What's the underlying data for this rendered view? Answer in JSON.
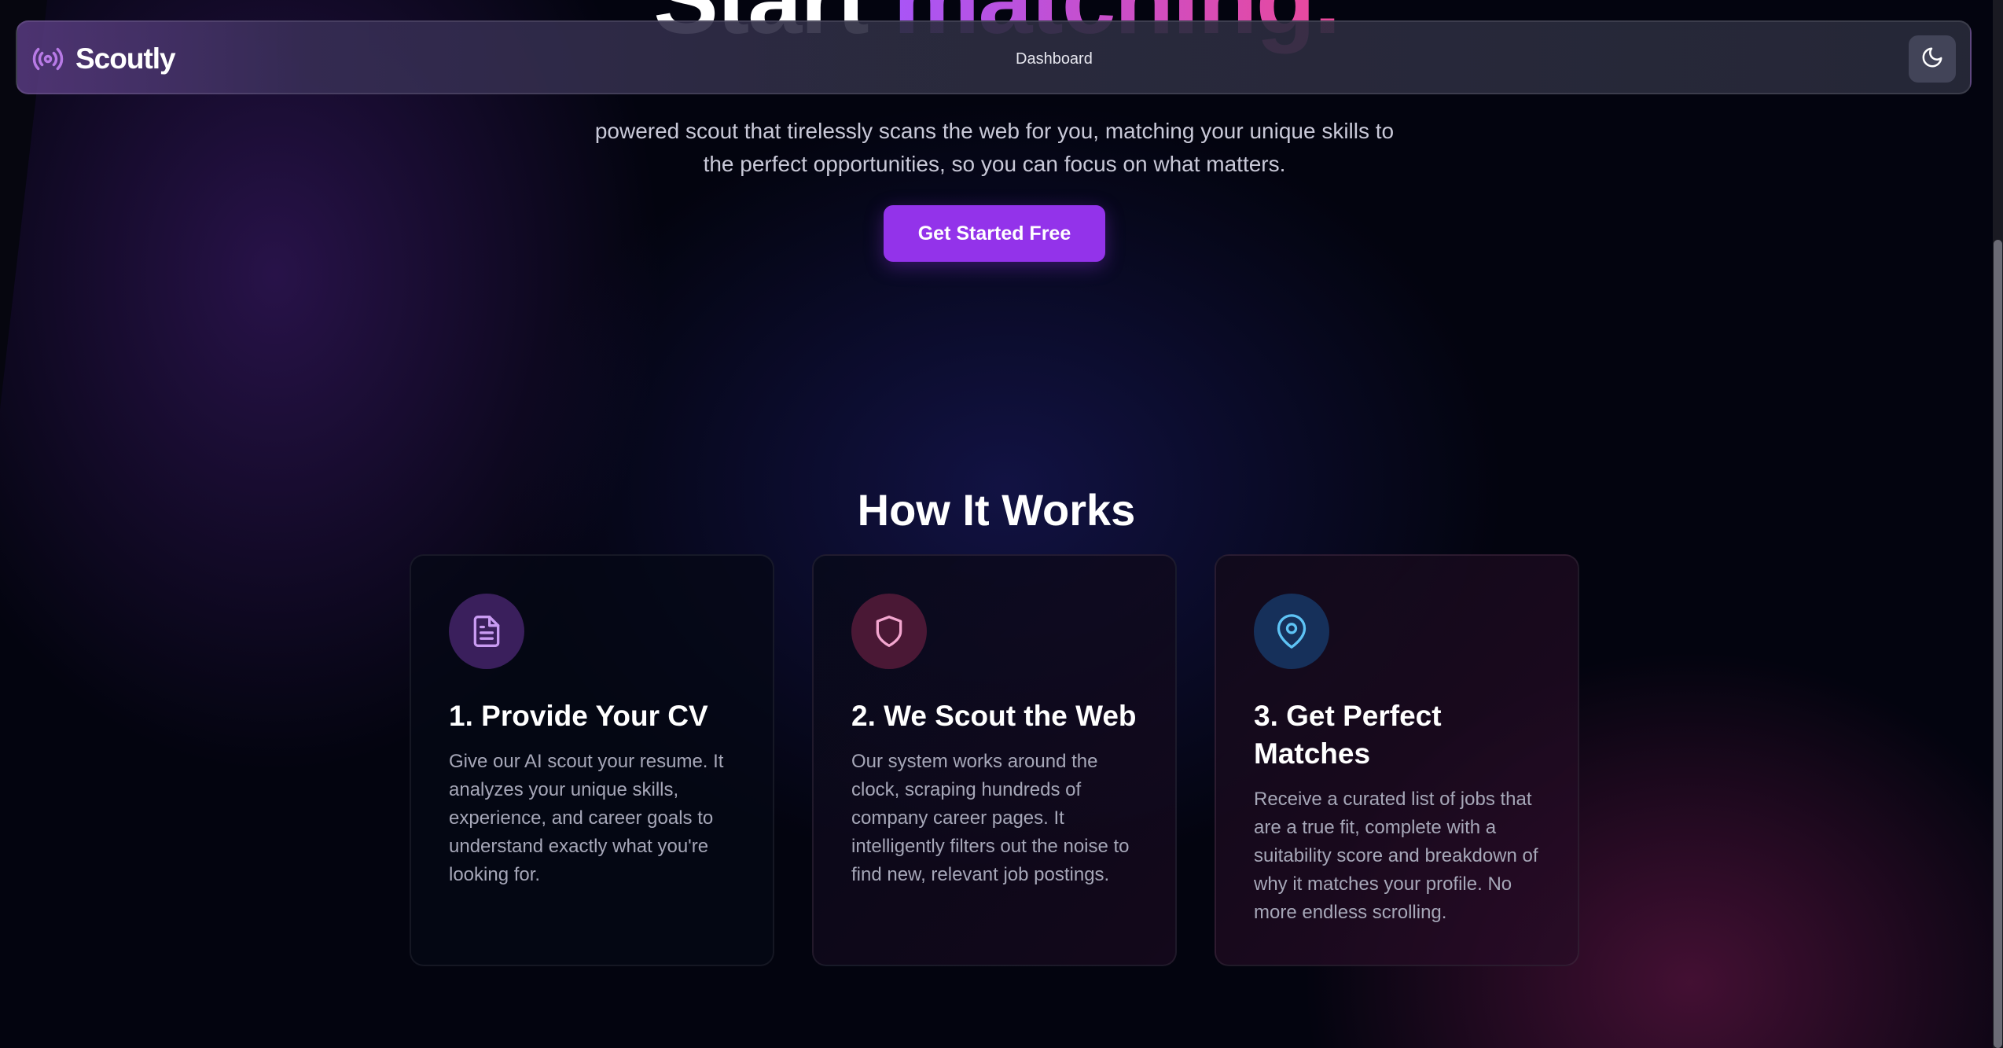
{
  "hero": {
    "title_word1": "Start",
    "title_word2": "matching.",
    "subtitle": "powered scout that tirelessly scans the web for you, matching your unique skills to the perfect opportunities, so you can focus on what matters.",
    "cta_label": "Get Started Free"
  },
  "navbar": {
    "brand": "Scoutly",
    "brand_icon": "radio-broadcast-icon",
    "link_dashboard": "Dashboard",
    "theme_toggle_icon": "moon-icon"
  },
  "how_it_works": {
    "title": "How It Works",
    "steps": [
      {
        "icon": "document-icon",
        "title": "1. Provide Your CV",
        "text": "Give our AI scout your resume. It analyzes your unique skills, experience, and career goals to understand exactly what you're looking for."
      },
      {
        "icon": "shield-icon",
        "title": "2. We Scout the Web",
        "text": "Our system works around the clock, scraping hundreds of company career pages. It intelligently filters out the noise to find new, relevant job postings."
      },
      {
        "icon": "map-pin-icon",
        "title": "3. Get Perfect Matches",
        "text": "Receive a curated list of jobs that are a true fit, complete with a suitability score and breakdown of why it matches your profile. No more endless scrolling."
      }
    ]
  },
  "colors": {
    "accent": "#9333ea",
    "gradient_start": "#a855f7",
    "gradient_end": "#ec4899",
    "background": "#03040f"
  }
}
